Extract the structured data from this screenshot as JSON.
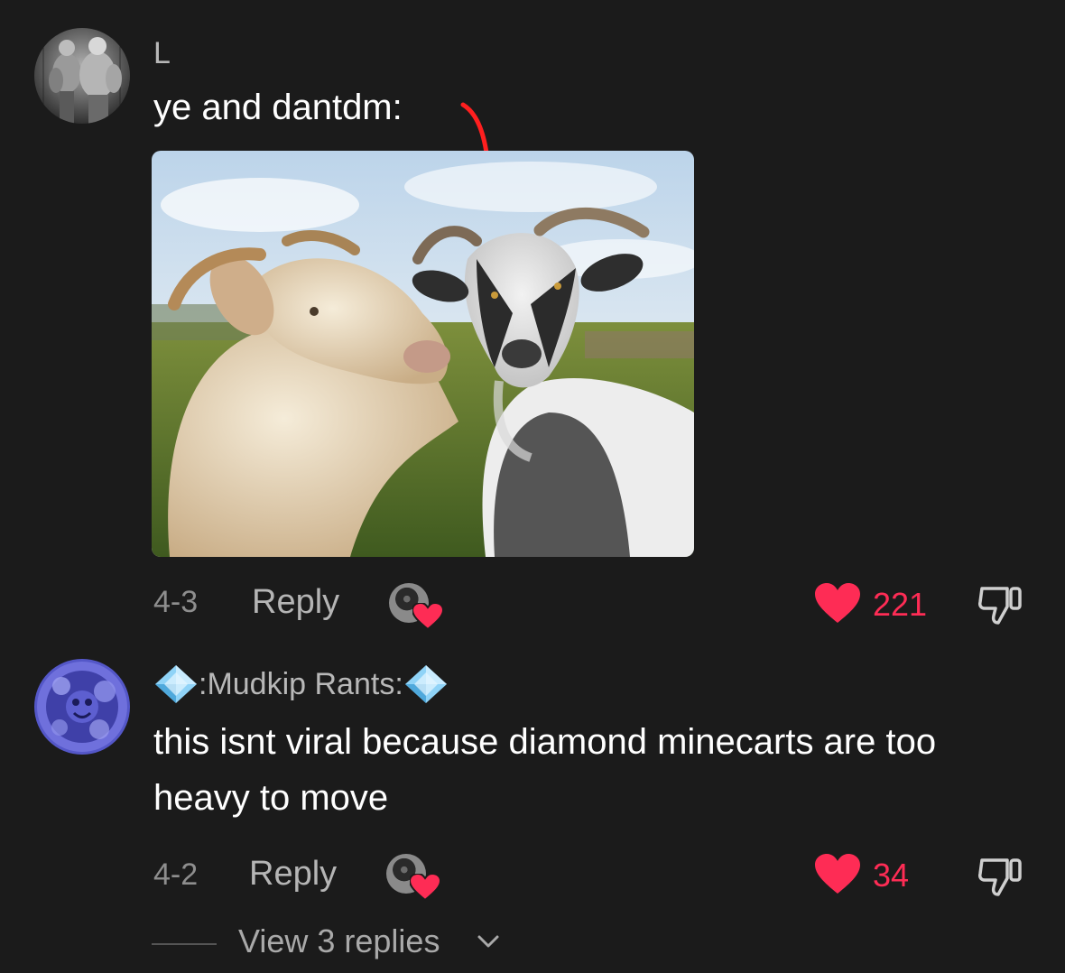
{
  "comments": [
    {
      "username": "L",
      "text": "ye and dantdm:",
      "date": "4-3",
      "reply_label": "Reply",
      "likes": "221",
      "avatar_icon": "muscle-men-avatar",
      "image": "two-goats-photo"
    },
    {
      "username": ":Mudkip Rants:",
      "username_emoji": "diamond-gem-icon",
      "text": "this isnt viral because diamond minecarts are too heavy to move",
      "date": "4-2",
      "reply_label": "Reply",
      "likes": "34",
      "avatar_icon": "blue-mudkip-avatar",
      "view_replies": "View 3 replies"
    }
  ],
  "colors": {
    "background": "#1b1b1b",
    "like_red": "#fe2c55",
    "muted_text": "#8e8e8e"
  }
}
